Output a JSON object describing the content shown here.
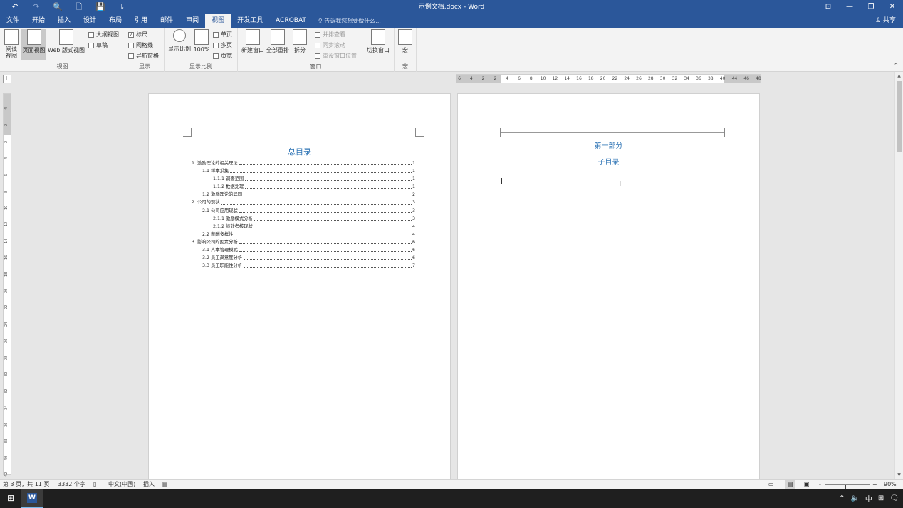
{
  "titlebar": {
    "title": "示例文档.docx - Word",
    "qat": [
      "↶",
      "↷",
      "🔍",
      "🗋",
      "💾",
      "⇂"
    ],
    "controls": [
      "⊡",
      "—",
      "❐",
      "✕"
    ]
  },
  "tabs": {
    "items": [
      "文件",
      "开始",
      "插入",
      "设计",
      "布局",
      "引用",
      "邮件",
      "审阅",
      "视图",
      "开发工具",
      "ACROBAT"
    ],
    "active_index": 8,
    "tell_me": "♀ 告诉我您想要做什么...",
    "share": "♙ 共享"
  },
  "ribbon": {
    "views": {
      "label": "视图",
      "read_mode": "阅读\n视图",
      "print_layout": "页面视图",
      "web_layout": "Web 版式视图",
      "outline": "大纲视图",
      "draft": "草稿"
    },
    "show": {
      "label": "显示",
      "ruler": "标尺",
      "ruler_checked": true,
      "gridlines": "网格线",
      "gridlines_checked": false,
      "nav_pane": "导航窗格",
      "nav_pane_checked": false
    },
    "zoom": {
      "label": "显示比例",
      "zoom": "显示比例",
      "hundred": "100%",
      "one_page": "单页",
      "multi_page": "多页",
      "page_width": "页宽"
    },
    "window": {
      "label": "窗口",
      "new_window": "新建窗口",
      "arrange_all": "全部重排",
      "split": "拆分",
      "side_by_side": "并排查看",
      "sync_scroll": "同步滚动",
      "reset_pos": "重设窗口位置",
      "switch_windows": "切换窗口"
    },
    "macros": {
      "label": "宏",
      "macros": "宏"
    }
  },
  "ruler": {
    "tab_selector": "L",
    "h_numbers": [
      "6",
      "4",
      "2",
      "2",
      "4",
      "6",
      "8",
      "10",
      "12",
      "14",
      "16",
      "18",
      "20",
      "22",
      "24",
      "26",
      "28",
      "30",
      "32",
      "34",
      "36",
      "38",
      "40",
      "44",
      "46",
      "48"
    ],
    "v_numbers": [
      "4",
      "2",
      "2",
      "4",
      "6",
      "8",
      "10",
      "12",
      "14",
      "16",
      "18",
      "20",
      "22",
      "24",
      "26",
      "28",
      "30",
      "32",
      "34",
      "36",
      "38",
      "40",
      "42"
    ]
  },
  "page1": {
    "title": "总目录",
    "toc": [
      {
        "level": 1,
        "text": "1. 激励理论的相关理论",
        "page": "1"
      },
      {
        "level": 2,
        "text": "1.1 样本采集",
        "page": "1"
      },
      {
        "level": 3,
        "text": "1.1.1 调查范围",
        "page": "1"
      },
      {
        "level": 3,
        "text": "1.1.2 数据处理",
        "page": "1"
      },
      {
        "level": 2,
        "text": "1.2 激励理论的异同",
        "page": "2"
      },
      {
        "level": 1,
        "text": "2. 公司的现状",
        "page": "3"
      },
      {
        "level": 2,
        "text": "2.1 公司应用现状",
        "page": "3"
      },
      {
        "level": 3,
        "text": "2.1.1 激励模式分析",
        "page": "3"
      },
      {
        "level": 3,
        "text": "2.1.2 绩效考核现状",
        "page": "4"
      },
      {
        "level": 2,
        "text": "2.2 薪酬多样性",
        "page": "4"
      },
      {
        "level": 1,
        "text": "3. 影响公司的因素分析",
        "page": "6"
      },
      {
        "level": 2,
        "text": "3.1 人本管理模式",
        "page": "6"
      },
      {
        "level": 2,
        "text": "3.2 员工满意度分析",
        "page": "6"
      },
      {
        "level": 2,
        "text": "3.3 员工职能性分析",
        "page": "7"
      }
    ]
  },
  "page2": {
    "part_title": "第一部分",
    "sub_title": "子目录",
    "ibeam": "I"
  },
  "status": {
    "page_info": "第 3 页，共 11 页",
    "word_count": "3332 个字",
    "proof_icon": "proofing-icon",
    "language": "中文(中国)",
    "mode": "插入",
    "macro_icon": "macro-record-icon",
    "zoom_minus": "-",
    "zoom_plus": "+",
    "zoom_level": "90%",
    "zoom_fraction": 0.45
  },
  "taskbar": {
    "start": "⊞",
    "word_letter": "W",
    "tray": [
      "⌃",
      "🔈",
      "中",
      "⊞",
      "🗨"
    ]
  }
}
